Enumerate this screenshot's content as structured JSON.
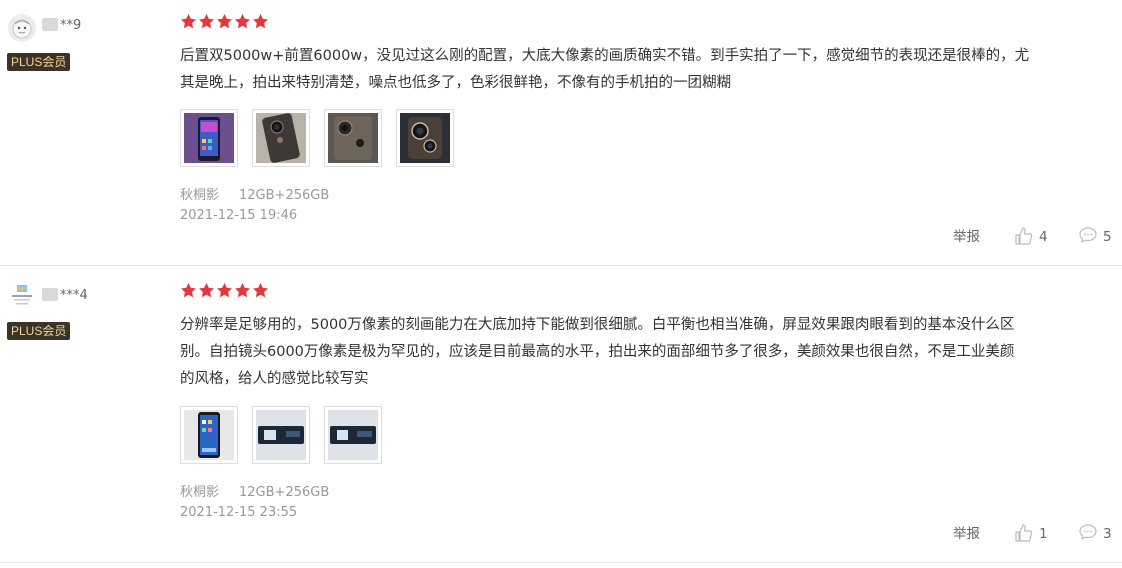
{
  "reviews": [
    {
      "username": "**9",
      "badge": "PLUS会员",
      "rating": 5,
      "content_line1": "后置双5000w+前置6000w，没见过这么刚的配置，大底大像素的画质确实不错。到手实拍了一下，感觉细节的表现还是很棒的，尤",
      "content_line2": "其是晚上，拍出来特别清楚，噪点也低多了，色彩很鲜艳，不像有的手机拍的一团糊糊",
      "color": "秋桐影",
      "spec": "12GB+256GB",
      "date": "2021-12-15 19:46",
      "report_label": "举报",
      "likes": "4",
      "comments": "5"
    },
    {
      "username": "***4",
      "badge": "PLUS会员",
      "rating": 5,
      "content_line1": "分辨率是足够用的，5000万像素的刻画能力在大底加持下能做到很细腻。白平衡也相当准确，屏显效果跟肉眼看到的基本没什么区",
      "content_line2": "别。自拍镜头6000万像素是极为罕见的，应该是目前最高的水平，拍出来的面部细节多了很多，美颜效果也很自然，不是工业美颜",
      "content_line3": "的风格，给人的感觉比较写实",
      "color": "秋桐影",
      "spec": "12GB+256GB",
      "date": "2021-12-15 23:55",
      "report_label": "举报",
      "likes": "1",
      "comments": "3"
    }
  ],
  "colors": {
    "star": "#e4393c",
    "badge_bg": "#3b3326",
    "badge_text": "#f3d49a",
    "divider": "#e5e5e5"
  },
  "icons": {
    "like": "thumbs-up-icon",
    "comment": "comment-bubble-icon",
    "star": "star-icon"
  }
}
